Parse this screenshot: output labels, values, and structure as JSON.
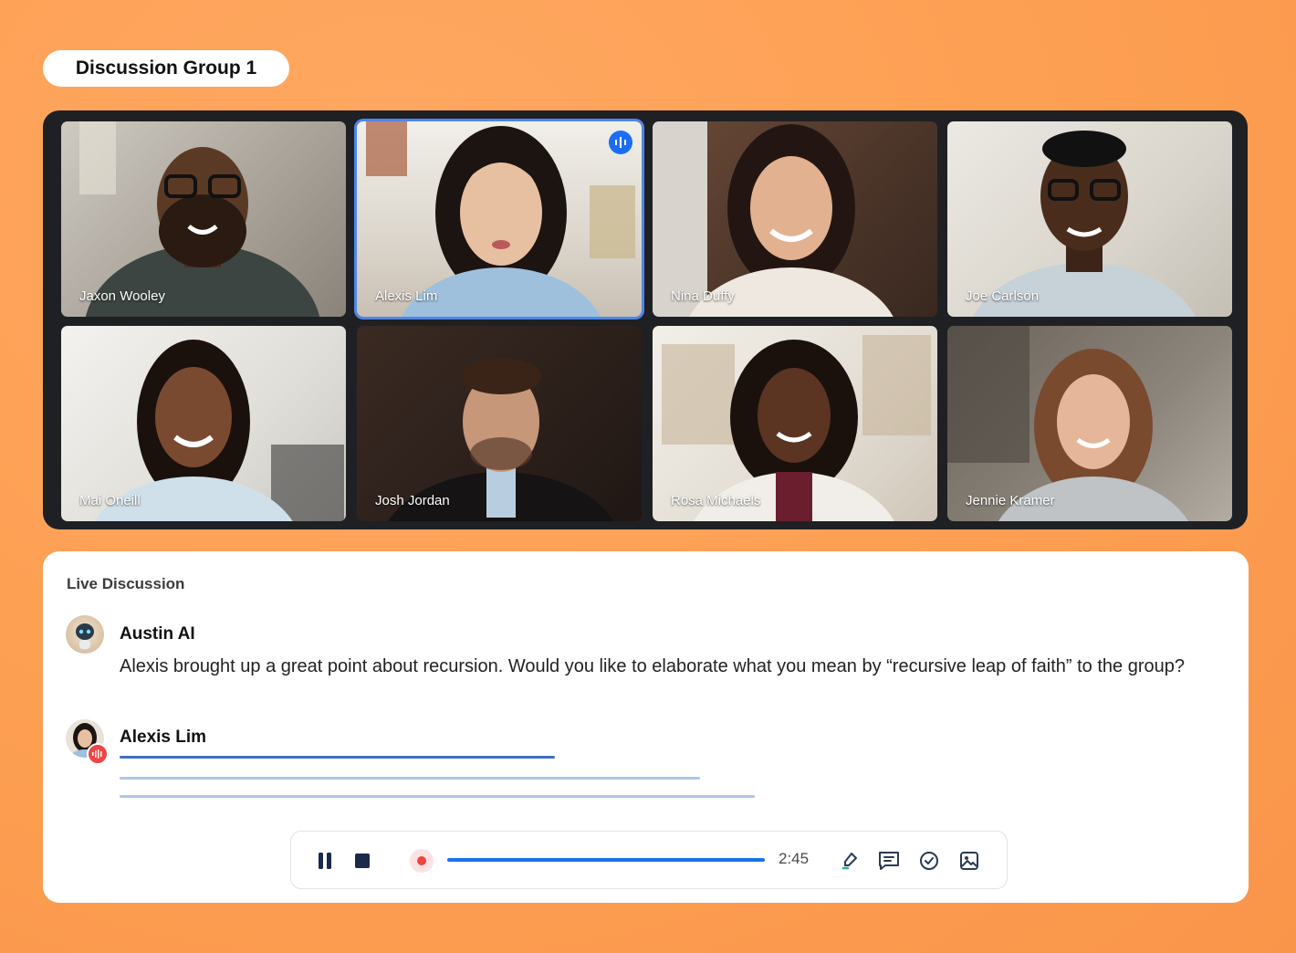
{
  "group": {
    "title": "Discussion Group 1"
  },
  "participants": [
    {
      "name": "Jaxon Wooley",
      "speaking": false
    },
    {
      "name": "Alexis Lim",
      "speaking": true
    },
    {
      "name": "Nina Duffy",
      "speaking": false
    },
    {
      "name": "Joe Carlson",
      "speaking": false
    },
    {
      "name": "Mai Oneill",
      "speaking": false
    },
    {
      "name": "Josh Jordan",
      "speaking": false
    },
    {
      "name": "Rosa Michaels",
      "speaking": false
    },
    {
      "name": "Jennie Kramer",
      "speaking": false
    }
  ],
  "discussion": {
    "title": "Live Discussion",
    "messages": [
      {
        "author": "Austin AI",
        "text": "Alexis brought up a great point about recursion. Would you like to elaborate what you mean by “recursive leap of faith” to the group?"
      },
      {
        "author": "Alexis Lim",
        "text": ""
      }
    ]
  },
  "controls": {
    "timer": "2:45",
    "icons": [
      "pause-icon",
      "stop-icon",
      "record-dot-icon",
      "highlighter-icon",
      "comment-icon",
      "check-circle-icon",
      "image-icon"
    ]
  },
  "colors": {
    "accent": "#1a73e8",
    "speaking": "#4f86e8",
    "record": "#ef4444",
    "background": "#fd9f52"
  }
}
